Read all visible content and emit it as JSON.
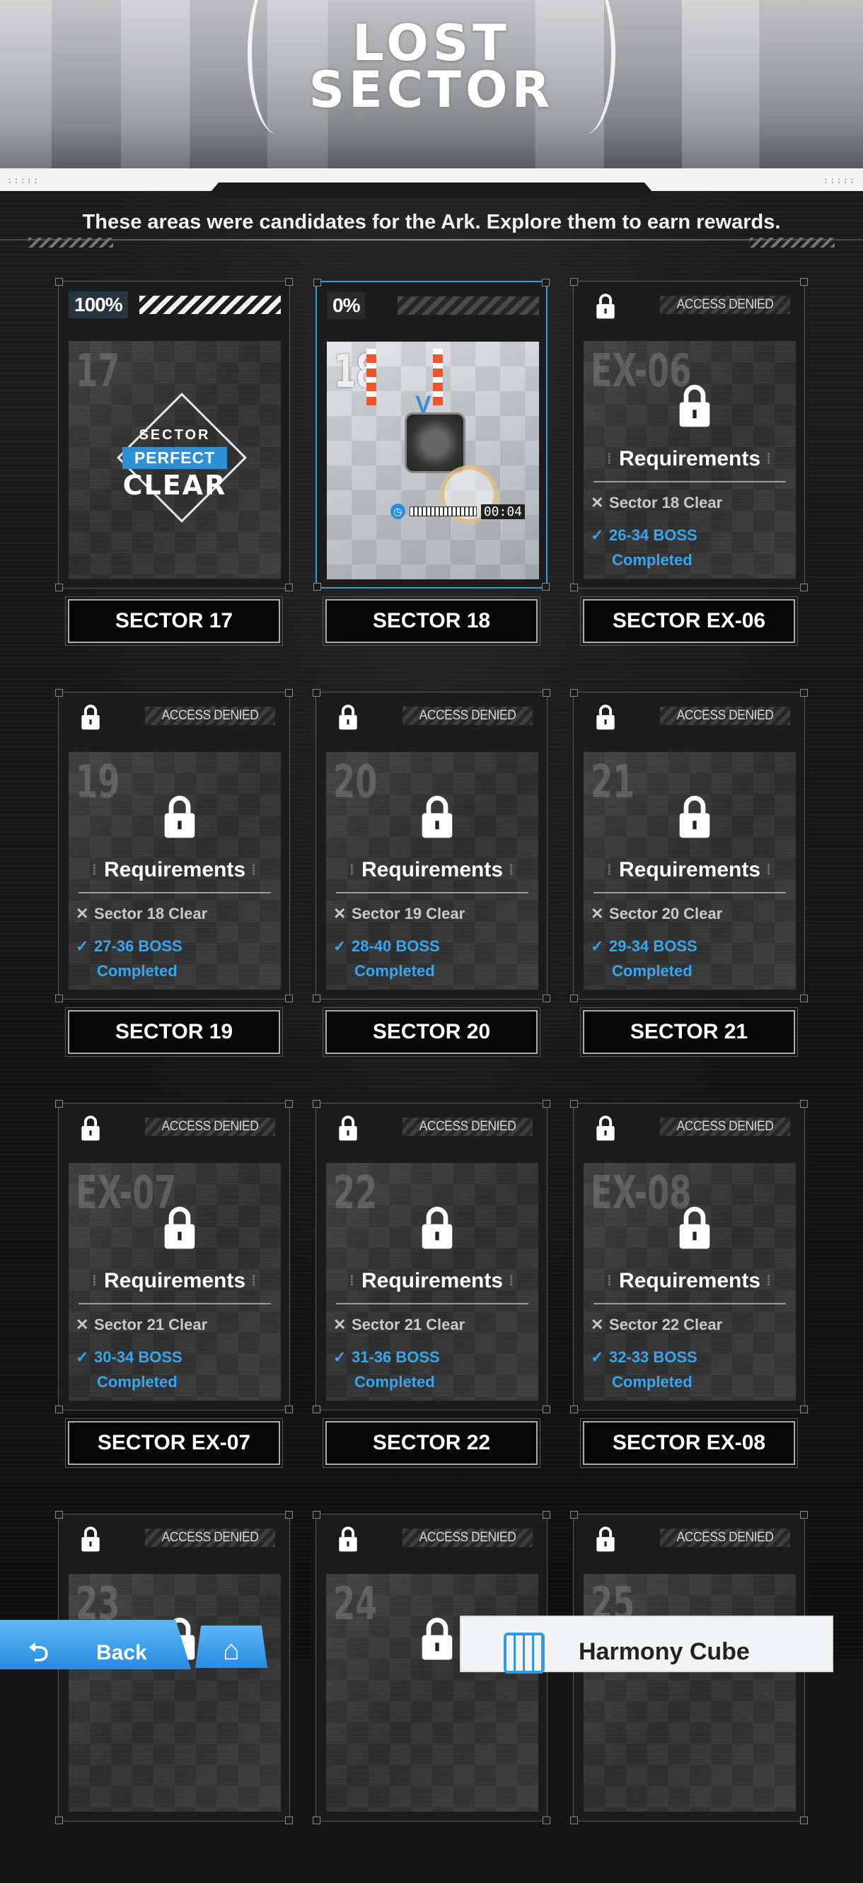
{
  "header": {
    "title_line1": "LOST",
    "title_line2": "SECTOR",
    "subtitle": "These areas were candidates for the Ark. Explore them to earn rewards."
  },
  "access_denied_label": "ACCESS DENIED",
  "requirements_title": "Requirements",
  "cards": [
    {
      "name": "SECTOR 17",
      "progress": "100%",
      "thumb_num": "17",
      "state": "cleared",
      "badge": {
        "line1": "SECTOR",
        "line2": "PERFECT",
        "line3": "CLEAR"
      }
    },
    {
      "name": "SECTOR 18",
      "progress": "0%",
      "thumb_num": "18",
      "state": "active",
      "timer": "00:04"
    },
    {
      "name": "SECTOR EX-06",
      "thumb_num": "EX-06",
      "state": "locked",
      "req1": "Sector 18 Clear",
      "req2a": "26-34 BOSS",
      "req2b": "Completed"
    },
    {
      "name": "SECTOR 19",
      "thumb_num": "19",
      "state": "locked",
      "req1": "Sector 18 Clear",
      "req2a": "27-36 BOSS",
      "req2b": "Completed"
    },
    {
      "name": "SECTOR 20",
      "thumb_num": "20",
      "state": "locked",
      "req1": "Sector 19 Clear",
      "req2a": "28-40 BOSS",
      "req2b": "Completed"
    },
    {
      "name": "SECTOR 21",
      "thumb_num": "21",
      "state": "locked",
      "req1": "Sector 20 Clear",
      "req2a": "29-34 BOSS",
      "req2b": "Completed"
    },
    {
      "name": "SECTOR EX-07",
      "thumb_num": "EX-07",
      "state": "locked",
      "req1": "Sector 21 Clear",
      "req2a": "30-34 BOSS",
      "req2b": "Completed"
    },
    {
      "name": "SECTOR 22",
      "thumb_num": "22",
      "state": "locked",
      "req1": "Sector 21 Clear",
      "req2a": "31-36 BOSS",
      "req2b": "Completed"
    },
    {
      "name": "SECTOR EX-08",
      "thumb_num": "EX-08",
      "state": "locked",
      "req1": "Sector 22 Clear",
      "req2a": "32-33 BOSS",
      "req2b": "Completed"
    },
    {
      "thumb_num": "23",
      "state": "locked-partial"
    },
    {
      "thumb_num": "24",
      "state": "locked-partial"
    },
    {
      "thumb_num": "25",
      "state": "locked-partial"
    }
  ],
  "bottom": {
    "back_label": "Back",
    "harmony_label": "Harmony Cube"
  },
  "colors": {
    "accent_blue": "#35a6f0",
    "active_border": "#3a9ad9",
    "button_blue": "#2a8be0"
  },
  "icons": [
    "lock-icon",
    "back-arrow-icon",
    "home-icon",
    "harmony-cube-icon",
    "clock-icon"
  ]
}
